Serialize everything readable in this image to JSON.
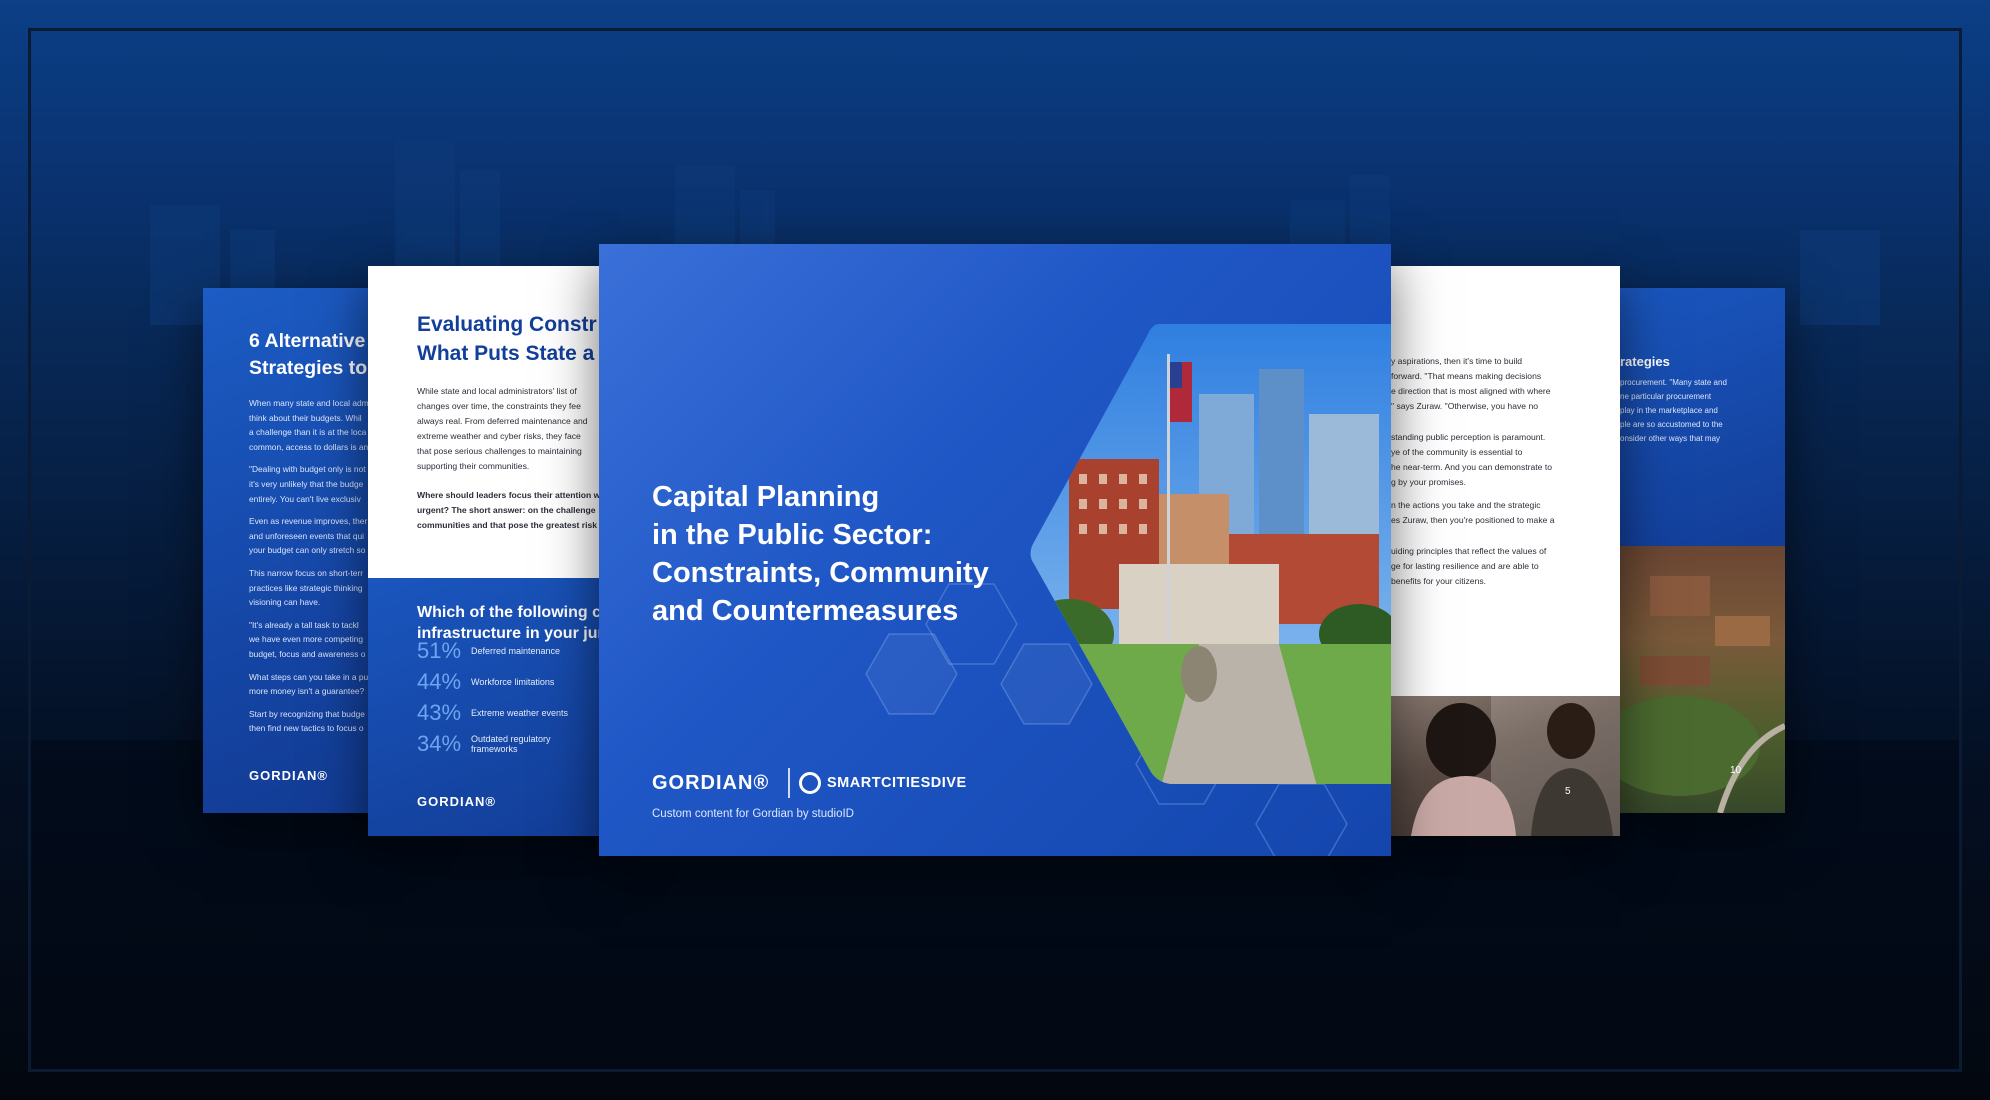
{
  "left_page": {
    "heading_lines": [
      "6 Alternative",
      "Strategies to"
    ],
    "body_lines": [
      "When many state and local adm",
      "think about their budgets. Whil",
      "a challenge than it is at the loca",
      "common, access to dollars is an",
      "",
      "\"Dealing with budget only is not",
      "it's very unlikely that the budge",
      "entirely. You can't live exclusiv",
      "",
      "Even as revenue improves, ther",
      "and unforeseen events that qui",
      "your budget can only stretch so",
      "",
      "This narrow focus on short-terr",
      "practices like strategic thinking",
      "visioning can have.",
      "",
      "\"It's already a tall task to tackl",
      "we have even more competing",
      "budget, focus and awareness o",
      "",
      "What steps can you take in a pu",
      "more money isn't a guarantee?",
      "",
      "Start by recognizing that budge",
      "then find new tactics to focus o"
    ],
    "brand": "GORDIAN®"
  },
  "eval_page": {
    "heading_lines": [
      "Evaluating Constr",
      "What Puts State a"
    ],
    "body_lines": [
      "While state and local administrators' list of",
      "changes over time, the constraints they fee",
      "always real. From deferred maintenance and",
      "extreme weather and cyber risks, they face",
      "that pose serious challenges to maintaining",
      "supporting their communities."
    ],
    "question_lines": [
      "Where should leaders focus their attention w",
      "urgent? The short answer: on the challenge",
      "communities and that pose the greatest risk"
    ],
    "survey_heading_lines": [
      "Which of the following cu",
      "infrastructure in your juri"
    ],
    "stats": [
      {
        "value": "51%",
        "label": "Deferred maintenance"
      },
      {
        "value": "44%",
        "label": "Workforce limitations"
      },
      {
        "value": "43%",
        "label": "Extreme weather events"
      },
      {
        "value": "34%",
        "label": "Outdated regulatory frameworks"
      }
    ],
    "brand": "GORDIAN®"
  },
  "cover": {
    "title_lines": [
      "Capital Planning",
      "in the Public Sector:",
      "Constraints, Community",
      "and Countermeasures"
    ],
    "brand_gordian": "GORDIAN®",
    "brand_partner": "SMARTCITIESDIVE",
    "subtitle": "Custom content for Gordian by studioID"
  },
  "right_page": {
    "body_lines": [
      "y aspirations, then it's time to build",
      "forward. \"That means making decisions",
      "e direction that is most aligned with where",
      "\" says Zuraw. \"Otherwise, you have no",
      "",
      "",
      "standing public perception is paramount.",
      "ye of the community is essential to",
      "he near-term. And you can demonstrate to",
      "g by your promises.",
      "",
      "n the actions you take and the strategic",
      "es Zuraw, then you're positioned to make a",
      "",
      "",
      "uiding principles that reflect the values of",
      "ge for lasting resilience and are able to",
      "benefits for your citizens."
    ],
    "page_number": "5"
  },
  "far_right_page": {
    "heading": "rategies",
    "body_lines": [
      "procurement. \"Many state and",
      "ne particular procurement",
      "play in the marketplace and",
      "ple are so accustomed to the",
      "onsider other ways that may"
    ],
    "page_number": "10"
  },
  "colors": {
    "brand_blue": "#1546a6",
    "heading_blue": "#123f9a",
    "stat_blue": "#6fa4ee"
  }
}
